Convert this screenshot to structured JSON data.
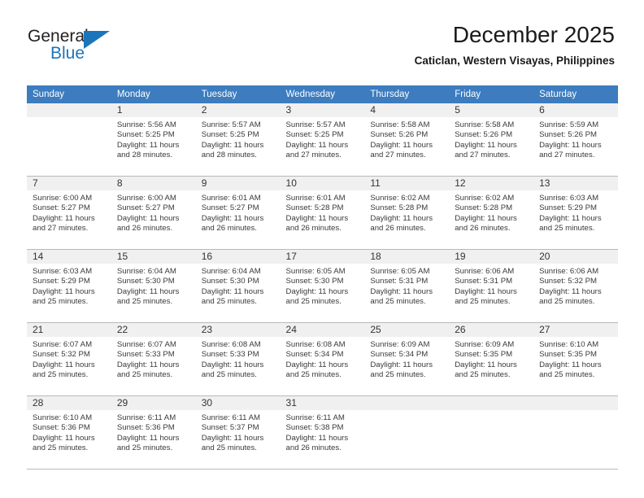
{
  "brand": {
    "word1": "General",
    "word2": "Blue",
    "logo_icon": "triangle-icon"
  },
  "header": {
    "month_title": "December 2025",
    "location": "Caticlan, Western Visayas, Philippines"
  },
  "colors": {
    "header_blue": "#3c7cbf",
    "brand_blue": "#1b75bb",
    "daynum_bg": "#f0f0f0",
    "row_border": "#b9b9b9"
  },
  "calendar": {
    "weekday_headers": [
      "Sunday",
      "Monday",
      "Tuesday",
      "Wednesday",
      "Thursday",
      "Friday",
      "Saturday"
    ],
    "weeks": [
      [
        {
          "day": "",
          "sunrise": "",
          "sunset": "",
          "daylight_1": "",
          "daylight_2": ""
        },
        {
          "day": "1",
          "sunrise": "Sunrise: 5:56 AM",
          "sunset": "Sunset: 5:25 PM",
          "daylight_1": "Daylight: 11 hours",
          "daylight_2": "and 28 minutes."
        },
        {
          "day": "2",
          "sunrise": "Sunrise: 5:57 AM",
          "sunset": "Sunset: 5:25 PM",
          "daylight_1": "Daylight: 11 hours",
          "daylight_2": "and 28 minutes."
        },
        {
          "day": "3",
          "sunrise": "Sunrise: 5:57 AM",
          "sunset": "Sunset: 5:25 PM",
          "daylight_1": "Daylight: 11 hours",
          "daylight_2": "and 27 minutes."
        },
        {
          "day": "4",
          "sunrise": "Sunrise: 5:58 AM",
          "sunset": "Sunset: 5:26 PM",
          "daylight_1": "Daylight: 11 hours",
          "daylight_2": "and 27 minutes."
        },
        {
          "day": "5",
          "sunrise": "Sunrise: 5:58 AM",
          "sunset": "Sunset: 5:26 PM",
          "daylight_1": "Daylight: 11 hours",
          "daylight_2": "and 27 minutes."
        },
        {
          "day": "6",
          "sunrise": "Sunrise: 5:59 AM",
          "sunset": "Sunset: 5:26 PM",
          "daylight_1": "Daylight: 11 hours",
          "daylight_2": "and 27 minutes."
        }
      ],
      [
        {
          "day": "7",
          "sunrise": "Sunrise: 6:00 AM",
          "sunset": "Sunset: 5:27 PM",
          "daylight_1": "Daylight: 11 hours",
          "daylight_2": "and 27 minutes."
        },
        {
          "day": "8",
          "sunrise": "Sunrise: 6:00 AM",
          "sunset": "Sunset: 5:27 PM",
          "daylight_1": "Daylight: 11 hours",
          "daylight_2": "and 26 minutes."
        },
        {
          "day": "9",
          "sunrise": "Sunrise: 6:01 AM",
          "sunset": "Sunset: 5:27 PM",
          "daylight_1": "Daylight: 11 hours",
          "daylight_2": "and 26 minutes."
        },
        {
          "day": "10",
          "sunrise": "Sunrise: 6:01 AM",
          "sunset": "Sunset: 5:28 PM",
          "daylight_1": "Daylight: 11 hours",
          "daylight_2": "and 26 minutes."
        },
        {
          "day": "11",
          "sunrise": "Sunrise: 6:02 AM",
          "sunset": "Sunset: 5:28 PM",
          "daylight_1": "Daylight: 11 hours",
          "daylight_2": "and 26 minutes."
        },
        {
          "day": "12",
          "sunrise": "Sunrise: 6:02 AM",
          "sunset": "Sunset: 5:28 PM",
          "daylight_1": "Daylight: 11 hours",
          "daylight_2": "and 26 minutes."
        },
        {
          "day": "13",
          "sunrise": "Sunrise: 6:03 AM",
          "sunset": "Sunset: 5:29 PM",
          "daylight_1": "Daylight: 11 hours",
          "daylight_2": "and 25 minutes."
        }
      ],
      [
        {
          "day": "14",
          "sunrise": "Sunrise: 6:03 AM",
          "sunset": "Sunset: 5:29 PM",
          "daylight_1": "Daylight: 11 hours",
          "daylight_2": "and 25 minutes."
        },
        {
          "day": "15",
          "sunrise": "Sunrise: 6:04 AM",
          "sunset": "Sunset: 5:30 PM",
          "daylight_1": "Daylight: 11 hours",
          "daylight_2": "and 25 minutes."
        },
        {
          "day": "16",
          "sunrise": "Sunrise: 6:04 AM",
          "sunset": "Sunset: 5:30 PM",
          "daylight_1": "Daylight: 11 hours",
          "daylight_2": "and 25 minutes."
        },
        {
          "day": "17",
          "sunrise": "Sunrise: 6:05 AM",
          "sunset": "Sunset: 5:30 PM",
          "daylight_1": "Daylight: 11 hours",
          "daylight_2": "and 25 minutes."
        },
        {
          "day": "18",
          "sunrise": "Sunrise: 6:05 AM",
          "sunset": "Sunset: 5:31 PM",
          "daylight_1": "Daylight: 11 hours",
          "daylight_2": "and 25 minutes."
        },
        {
          "day": "19",
          "sunrise": "Sunrise: 6:06 AM",
          "sunset": "Sunset: 5:31 PM",
          "daylight_1": "Daylight: 11 hours",
          "daylight_2": "and 25 minutes."
        },
        {
          "day": "20",
          "sunrise": "Sunrise: 6:06 AM",
          "sunset": "Sunset: 5:32 PM",
          "daylight_1": "Daylight: 11 hours",
          "daylight_2": "and 25 minutes."
        }
      ],
      [
        {
          "day": "21",
          "sunrise": "Sunrise: 6:07 AM",
          "sunset": "Sunset: 5:32 PM",
          "daylight_1": "Daylight: 11 hours",
          "daylight_2": "and 25 minutes."
        },
        {
          "day": "22",
          "sunrise": "Sunrise: 6:07 AM",
          "sunset": "Sunset: 5:33 PM",
          "daylight_1": "Daylight: 11 hours",
          "daylight_2": "and 25 minutes."
        },
        {
          "day": "23",
          "sunrise": "Sunrise: 6:08 AM",
          "sunset": "Sunset: 5:33 PM",
          "daylight_1": "Daylight: 11 hours",
          "daylight_2": "and 25 minutes."
        },
        {
          "day": "24",
          "sunrise": "Sunrise: 6:08 AM",
          "sunset": "Sunset: 5:34 PM",
          "daylight_1": "Daylight: 11 hours",
          "daylight_2": "and 25 minutes."
        },
        {
          "day": "25",
          "sunrise": "Sunrise: 6:09 AM",
          "sunset": "Sunset: 5:34 PM",
          "daylight_1": "Daylight: 11 hours",
          "daylight_2": "and 25 minutes."
        },
        {
          "day": "26",
          "sunrise": "Sunrise: 6:09 AM",
          "sunset": "Sunset: 5:35 PM",
          "daylight_1": "Daylight: 11 hours",
          "daylight_2": "and 25 minutes."
        },
        {
          "day": "27",
          "sunrise": "Sunrise: 6:10 AM",
          "sunset": "Sunset: 5:35 PM",
          "daylight_1": "Daylight: 11 hours",
          "daylight_2": "and 25 minutes."
        }
      ],
      [
        {
          "day": "28",
          "sunrise": "Sunrise: 6:10 AM",
          "sunset": "Sunset: 5:36 PM",
          "daylight_1": "Daylight: 11 hours",
          "daylight_2": "and 25 minutes."
        },
        {
          "day": "29",
          "sunrise": "Sunrise: 6:11 AM",
          "sunset": "Sunset: 5:36 PM",
          "daylight_1": "Daylight: 11 hours",
          "daylight_2": "and 25 minutes."
        },
        {
          "day": "30",
          "sunrise": "Sunrise: 6:11 AM",
          "sunset": "Sunset: 5:37 PM",
          "daylight_1": "Daylight: 11 hours",
          "daylight_2": "and 25 minutes."
        },
        {
          "day": "31",
          "sunrise": "Sunrise: 6:11 AM",
          "sunset": "Sunset: 5:38 PM",
          "daylight_1": "Daylight: 11 hours",
          "daylight_2": "and 26 minutes."
        },
        {
          "day": "",
          "sunrise": "",
          "sunset": "",
          "daylight_1": "",
          "daylight_2": ""
        },
        {
          "day": "",
          "sunrise": "",
          "sunset": "",
          "daylight_1": "",
          "daylight_2": ""
        },
        {
          "day": "",
          "sunrise": "",
          "sunset": "",
          "daylight_1": "",
          "daylight_2": ""
        }
      ]
    ]
  }
}
